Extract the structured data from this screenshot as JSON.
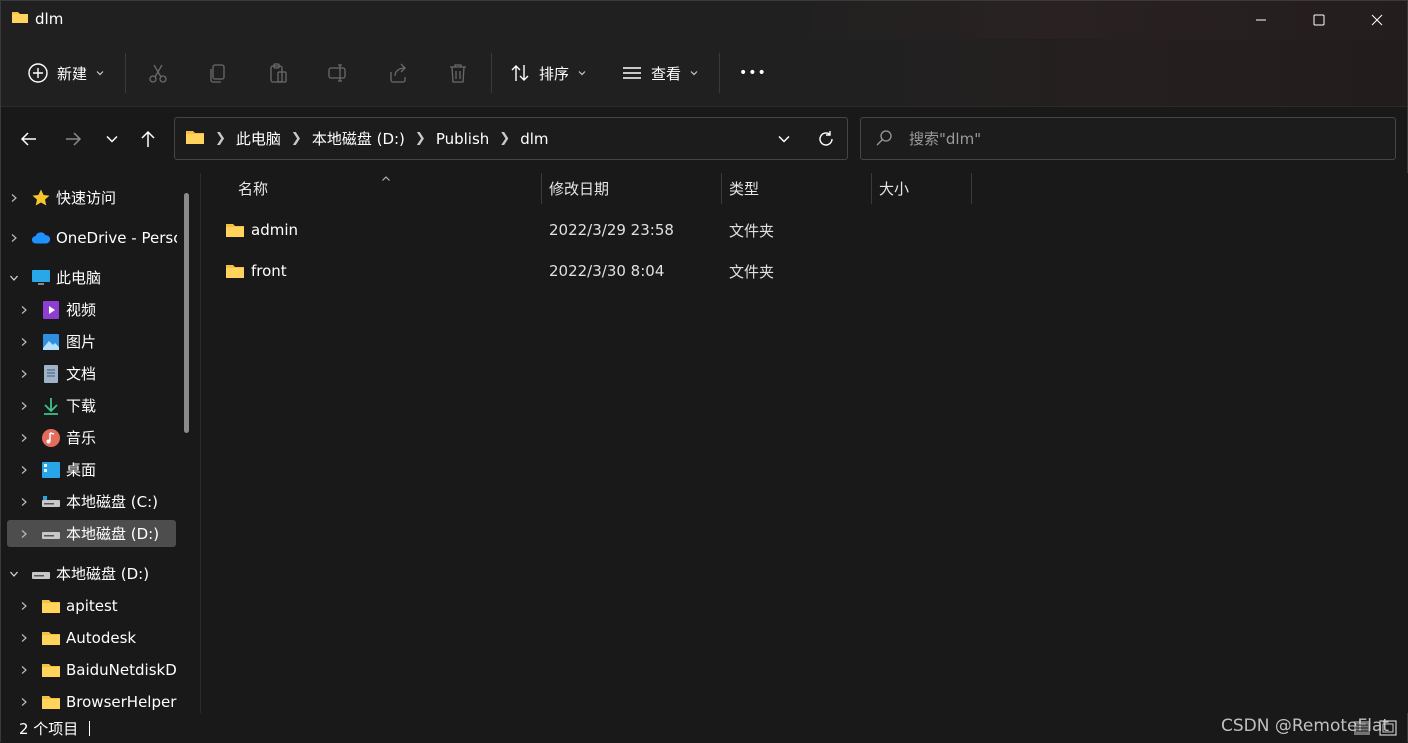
{
  "window": {
    "title": "dlm",
    "folder_color": "#f5c042"
  },
  "toolbar": {
    "new_label": "新建",
    "sort_label": "排序",
    "view_label": "查看",
    "more_label": "•••"
  },
  "address": {
    "crumbs": [
      "此电脑",
      "本地磁盘 (D:)",
      "Publish",
      "dlm"
    ]
  },
  "search": {
    "placeholder": "搜索\"dlm\""
  },
  "sidebar": {
    "items": [
      {
        "label": "快速访问",
        "icon": "star-icon"
      },
      {
        "label": "OneDrive - Persc",
        "icon": "cloud-icon"
      },
      {
        "label": "此电脑",
        "icon": "monitor-icon"
      },
      {
        "label": "视频",
        "icon": "video-icon"
      },
      {
        "label": "图片",
        "icon": "image-icon"
      },
      {
        "label": "文档",
        "icon": "document-icon"
      },
      {
        "label": "下载",
        "icon": "download-icon"
      },
      {
        "label": "音乐",
        "icon": "music-icon"
      },
      {
        "label": "桌面",
        "icon": "desktop-icon"
      },
      {
        "label": "本地磁盘 (C:)",
        "icon": "drive-icon"
      },
      {
        "label": "本地磁盘 (D:)",
        "icon": "drive-icon"
      },
      {
        "label": "本地磁盘 (D:)",
        "icon": "drive-icon"
      },
      {
        "label": "apitest",
        "icon": "folder-icon"
      },
      {
        "label": "Autodesk",
        "icon": "folder-icon"
      },
      {
        "label": "BaiduNetdiskD",
        "icon": "folder-icon"
      },
      {
        "label": "BrowserHelper",
        "icon": "folder-icon"
      }
    ]
  },
  "columns": {
    "name": "名称",
    "modified": "修改日期",
    "type": "类型",
    "size": "大小"
  },
  "files": [
    {
      "name": "admin",
      "modified": "2022/3/29 23:58",
      "type": "文件夹",
      "size": ""
    },
    {
      "name": "front",
      "modified": "2022/3/30 8:04",
      "type": "文件夹",
      "size": ""
    }
  ],
  "status": {
    "count": "2 个项目",
    "watermark": "CSDN @RemoteFlat"
  }
}
